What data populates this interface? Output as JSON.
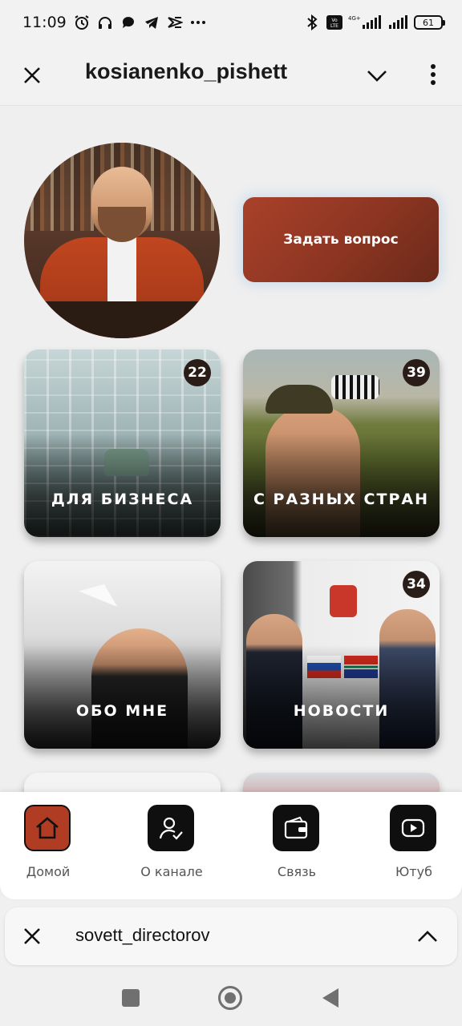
{
  "status_bar": {
    "time": "11:09",
    "battery": "61",
    "network_label": "4G+",
    "icons": [
      "alarm-icon",
      "headphones-icon",
      "chat-bubble-icon",
      "telegram-icon",
      "capcut-icon",
      "more-dots-icon",
      "bluetooth-icon",
      "volte-icon",
      "signal-icon",
      "battery-icon"
    ]
  },
  "header": {
    "title": "kosianenko_pishett"
  },
  "main": {
    "ask_button": "Задать вопрос",
    "tiles": [
      {
        "label": "ДЛЯ БИЗНЕСА",
        "count": "22"
      },
      {
        "label": "С РАЗНЫХ СТРАН",
        "count": "39"
      },
      {
        "label": "ОБО МНЕ",
        "count": ""
      },
      {
        "label": "НОВОСТИ",
        "count": "34"
      }
    ]
  },
  "bottom_nav": {
    "items": [
      {
        "label": "Домой",
        "icon": "home-icon",
        "active": true
      },
      {
        "label": "О канале",
        "icon": "user-check-icon",
        "active": false
      },
      {
        "label": "Связь",
        "icon": "wallet-icon",
        "active": false
      },
      {
        "label": "Ютуб",
        "icon": "youtube-icon",
        "active": false
      }
    ]
  },
  "minibar": {
    "title": "sovett_directorov"
  },
  "colors": {
    "accent": "#b03c24",
    "button_gradient_start": "#a9412a",
    "button_gradient_end": "#6a291a",
    "nav_icon_bg": "#0f0f0f"
  }
}
